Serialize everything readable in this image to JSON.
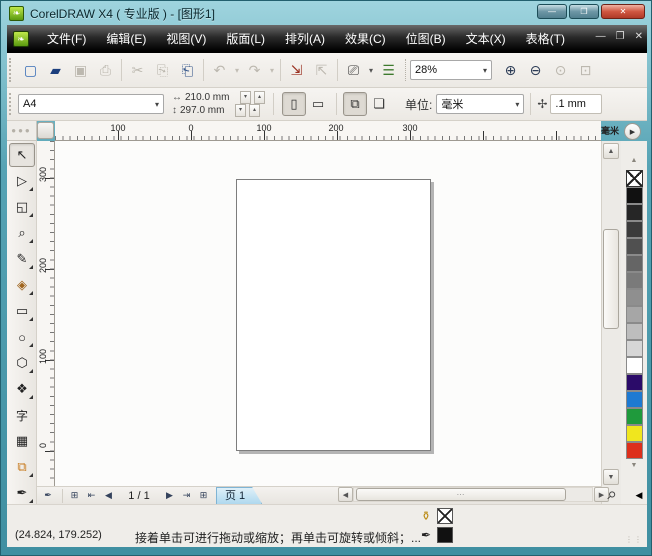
{
  "window": {
    "title": "CorelDRAW X4 ( 专业版 ) - [图形1]",
    "app_icon_glyph": "❧",
    "minimize_glyph": "—",
    "maximize_glyph": "❐",
    "close_glyph": "✕"
  },
  "menubar": {
    "items": [
      "文件(F)",
      "编辑(E)",
      "视图(V)",
      "版面(L)",
      "排列(A)",
      "效果(C)",
      "位图(B)",
      "文本(X)",
      "表格(T)"
    ],
    "mdi_minimize_glyph": "—",
    "mdi_restore_glyph": "❐",
    "mdi_close_glyph": "✕"
  },
  "toolbar": {
    "buttons": [
      {
        "name": "new-document",
        "glyph": "▢"
      },
      {
        "name": "open",
        "glyph": "▰"
      },
      {
        "name": "save",
        "glyph": "▣"
      },
      {
        "name": "print",
        "glyph": "⎙"
      },
      {
        "name": "cut",
        "glyph": "✂"
      },
      {
        "name": "copy",
        "glyph": "⎘"
      },
      {
        "name": "paste",
        "glyph": "⎗"
      },
      {
        "name": "undo",
        "glyph": "↶"
      },
      {
        "name": "redo",
        "glyph": "↷"
      },
      {
        "name": "import",
        "glyph": "⇲"
      },
      {
        "name": "export",
        "glyph": "⇱"
      },
      {
        "name": "application-launcher",
        "glyph": "⎚"
      },
      {
        "name": "welcome-screen",
        "glyph": "☰"
      },
      {
        "name": "zoom-in",
        "glyph": "⊕"
      },
      {
        "name": "zoom-out",
        "glyph": "⊖"
      },
      {
        "name": "zoom-actual",
        "glyph": "⊙"
      },
      {
        "name": "zoom-to-page",
        "glyph": "⊡"
      }
    ],
    "dropdown_caret": "▾",
    "zoom_level": "28%"
  },
  "property_bar": {
    "page_size": "A4",
    "width_icon_glyph": "↔",
    "paper_width": "210.0 mm",
    "height_icon_glyph": "↕",
    "paper_height": "297.0 mm",
    "spin_up_glyph": "▴",
    "spin_down_glyph": "▾",
    "portrait_glyph": "▯",
    "landscape_glyph": "▭",
    "all_pages_glyph": "⧉",
    "single_page_glyph": "❏",
    "units_label": "单位:",
    "units_value": "毫米",
    "nudge_icon_glyph": "✢",
    "nudge_value": ".1 mm"
  },
  "rulers": {
    "h_labels": [
      "100",
      "0",
      "100",
      "200",
      "300"
    ],
    "h_unit": "毫米",
    "v_labels": [
      "300",
      "200",
      "100",
      "0"
    ],
    "flyout_glyph": "▶"
  },
  "toolbox": {
    "tools": [
      {
        "name": "pick-tool",
        "glyph": "↖"
      },
      {
        "name": "shape-tool",
        "glyph": "▷"
      },
      {
        "name": "crop-tool",
        "glyph": "◱"
      },
      {
        "name": "zoom-tool",
        "glyph": "⌕"
      },
      {
        "name": "freehand-tool",
        "glyph": "✎"
      },
      {
        "name": "smart-fill-tool",
        "glyph": "◈"
      },
      {
        "name": "rectangle-tool",
        "glyph": "▭"
      },
      {
        "name": "ellipse-tool",
        "glyph": "○"
      },
      {
        "name": "polygon-tool",
        "glyph": "⬡"
      },
      {
        "name": "basic-shapes-tool",
        "glyph": "❖"
      },
      {
        "name": "text-tool",
        "glyph": "字"
      },
      {
        "name": "table-tool",
        "glyph": "▦"
      },
      {
        "name": "blend-tool",
        "glyph": "⧉"
      },
      {
        "name": "eyedropper-tool",
        "glyph": "✒"
      }
    ]
  },
  "palette": {
    "scroll_up_glyph": "▲",
    "scroll_down_glyph": "▼",
    "expand_glyph": "◀",
    "colors": [
      "#111111",
      "#262626",
      "#3b3b3b",
      "#505050",
      "#656565",
      "#7a7a7a",
      "#8f8f8f",
      "#a6a6a6",
      "#bdbdbd",
      "#d6d6d6",
      "#ffffff",
      "#2b0b69",
      "#1e7ad2",
      "#1f9a3c",
      "#f0e61e",
      "#dd2f1b"
    ]
  },
  "page_nav": {
    "outline_tool_glyph": "✒",
    "add_page_glyph": "⊞",
    "first_glyph": "⇤",
    "prev_glyph": "◀",
    "page_indicator": "1 / 1",
    "next_glyph": "▶",
    "last_glyph": "⇥",
    "tab_label": "页 1",
    "hscroll_left_glyph": "◀",
    "hscroll_right_glyph": "▶",
    "hthumb_grip": "⋯",
    "navigator_glyph": "⚲",
    "vscroll_up_glyph": "▲",
    "vscroll_down_glyph": "▼"
  },
  "status_bar": {
    "coords": "(24.824, 179.252)",
    "message": "接着单击可进行拖动或缩放；再单击可旋转或倾斜；...",
    "fill_icon_glyph": "⚱",
    "outline_icon_glyph": "✒",
    "resize_grip": "⋮⋮"
  }
}
